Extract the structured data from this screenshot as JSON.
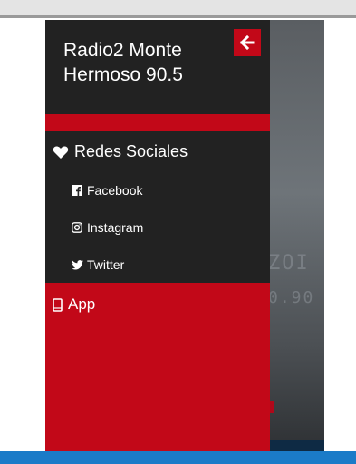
{
  "drawer": {
    "title": "Radio2 Monte Hermoso 90.5",
    "back_icon": "arrow-left-icon",
    "section": {
      "icon": "heart-icon",
      "label": "Redes Sociales"
    },
    "items": [
      {
        "icon": "facebook-icon",
        "label": "Facebook"
      },
      {
        "icon": "instagram-icon",
        "label": "Instagram"
      },
      {
        "icon": "twitter-icon",
        "label": "Twitter"
      }
    ],
    "app": {
      "icon": "mobile-icon",
      "label": "App"
    }
  },
  "colors": {
    "accent": "#c20818",
    "drawer_bg": "#222222",
    "text": "#ffffff"
  }
}
